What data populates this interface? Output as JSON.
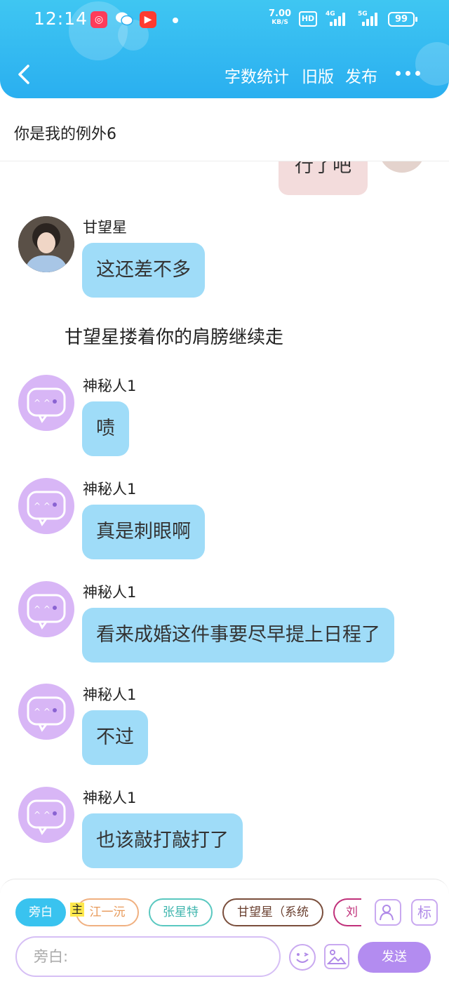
{
  "status_bar": {
    "time": "12:14",
    "speed_value": "7.00",
    "speed_unit": "KB/S",
    "hd_label": "HD",
    "sig1_label": "4G",
    "sig2_label": "5G",
    "battery": "99"
  },
  "header": {
    "word_count": "字数统计",
    "old_version": "旧版",
    "publish": "发布",
    "title": "你是我的例外6"
  },
  "messages": {
    "partial_self_text": "行了吧",
    "m1": {
      "name": "甘望星",
      "text": "这还差不多"
    },
    "narration": "甘望星搂着你的肩膀继续走",
    "m2": {
      "name": "神秘人1",
      "text": "啧"
    },
    "m3": {
      "name": "神秘人1",
      "text": "真是刺眼啊"
    },
    "m4": {
      "name": "神秘人1",
      "text": "看来成婚这件事要尽早提上日程了"
    },
    "m5": {
      "name": "神秘人1",
      "text": "不过"
    },
    "m6": {
      "name": "神秘人1",
      "text": "也该敲打敲打了"
    }
  },
  "panel": {
    "chips": [
      "旁白",
      "江一沅",
      "张星特",
      "甘望星（系统",
      "刘"
    ],
    "main_badge": "主",
    "tag_button": "标",
    "input_placeholder": "旁白:",
    "send": "发送"
  },
  "colors": {
    "header_blue": "#2aaff0",
    "bubble_blue": "#9fdcf8",
    "self_bubble": "#f3dcdc",
    "avatar_purple": "#d8b6f6",
    "send_purple": "#b38cf0"
  }
}
